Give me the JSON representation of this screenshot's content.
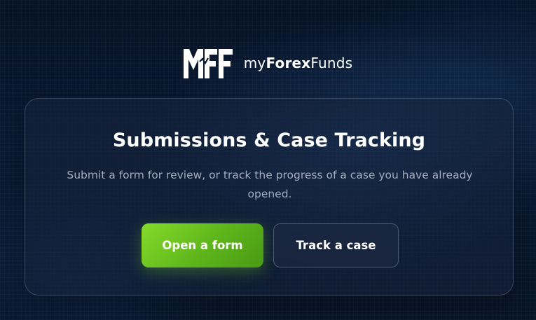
{
  "brand": {
    "logo_mark": "MFF",
    "name_prefix": "my",
    "name_bold": "Forex",
    "name_suffix": "Funds"
  },
  "card": {
    "title": "Submissions & Case Tracking",
    "description": "Submit a form for review, or track the progress of a case you have already opened."
  },
  "actions": {
    "open_form_label": "Open a form",
    "track_case_label": "Track a case"
  },
  "colors": {
    "background": "#0a1a33",
    "primary_button": "#6cc31f",
    "text_primary": "#ffffff",
    "text_secondary": "#a3adbd"
  }
}
